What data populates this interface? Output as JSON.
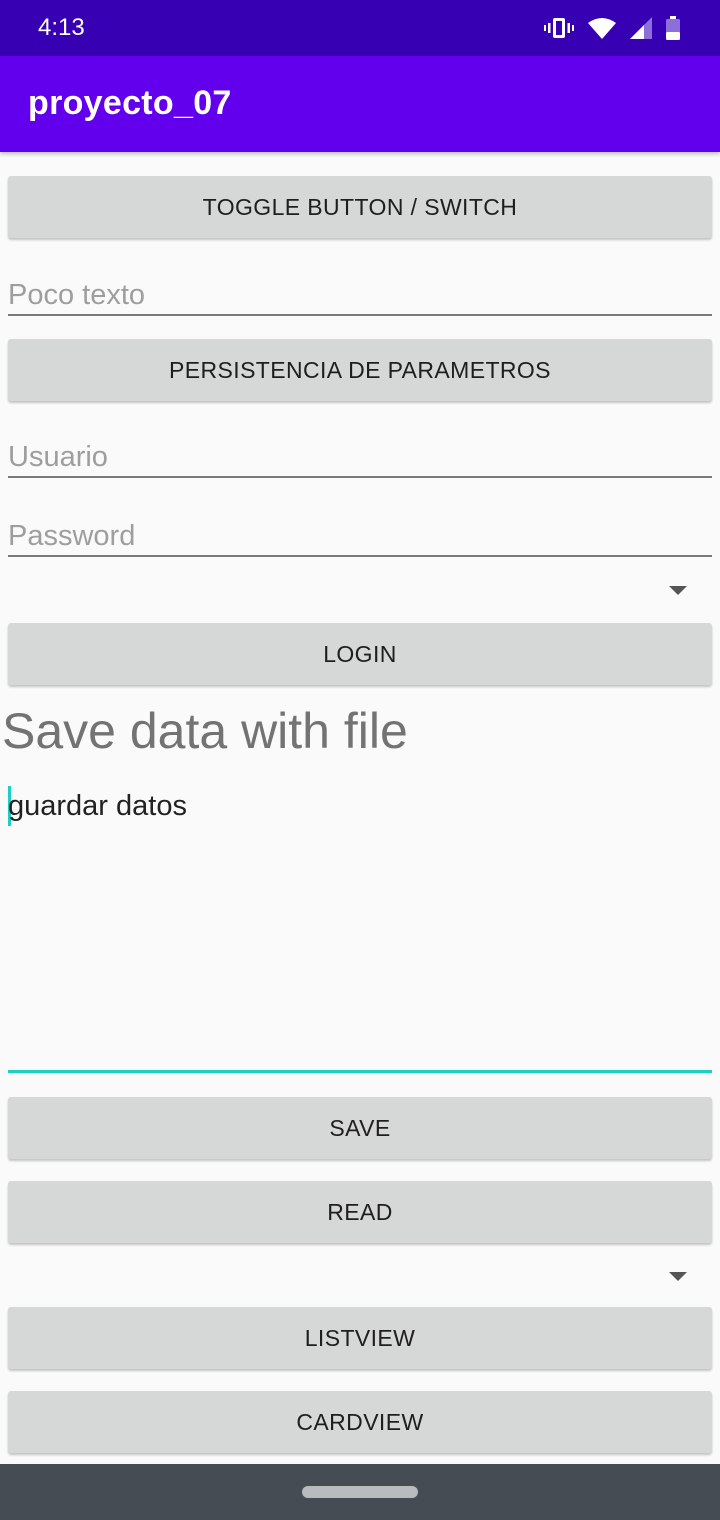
{
  "status_bar": {
    "time": "4:13",
    "icons": [
      "vibrate-icon",
      "wifi-icon",
      "signal-icon",
      "battery-icon"
    ]
  },
  "app_bar": {
    "title": "proyecto_07"
  },
  "buttons": {
    "toggle": "TOGGLE BUTTON / SWITCH",
    "persistencia": "PERSISTENCIA DE PARAMETROS",
    "login": "LOGIN",
    "save": "SAVE",
    "read": "READ",
    "listview": "LISTVIEW",
    "cardview": "CARDVIEW"
  },
  "fields": {
    "poco_texto": {
      "placeholder": "Poco texto",
      "value": ""
    },
    "usuario": {
      "placeholder": "Usuario",
      "value": ""
    },
    "password": {
      "placeholder": "Password",
      "value": ""
    }
  },
  "spinners": [
    {
      "selected": ""
    },
    {
      "selected": ""
    }
  ],
  "file_section": {
    "title": "Save data with file",
    "text": "guardar datos"
  },
  "colors": {
    "status_bar": "#3700b3",
    "app_bar": "#6200ee",
    "accent": "#1ccfc4",
    "button": "#d6d7d7",
    "nav_bar": "#464c53"
  }
}
